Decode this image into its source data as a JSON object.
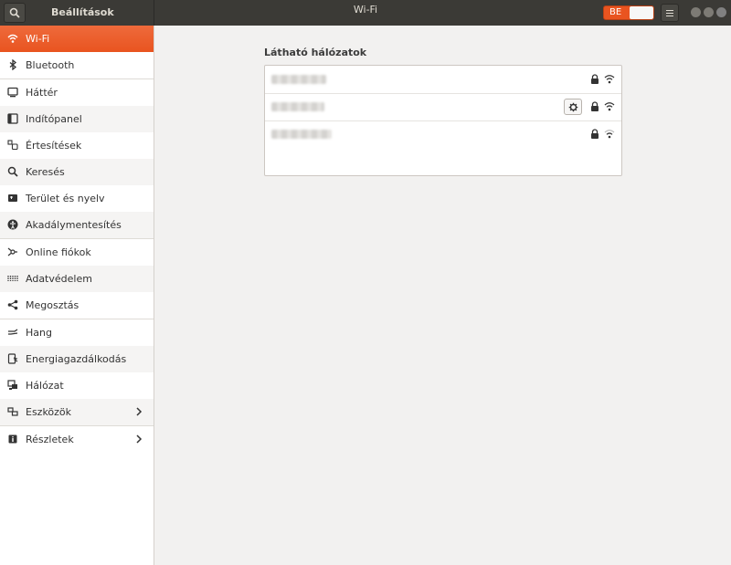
{
  "header": {
    "app_title": "Beállítások",
    "window_title": "Wi-Fi",
    "wifi_switch_label": "BE"
  },
  "sidebar": {
    "items": [
      {
        "label": "Wi-Fi",
        "icon": "wifi-icon",
        "active": true
      },
      {
        "label": "Bluetooth",
        "icon": "bluetooth-icon"
      },
      {
        "label": "Háttér",
        "icon": "background-icon"
      },
      {
        "label": "Indítópanel",
        "icon": "dock-icon"
      },
      {
        "label": "Értesítések",
        "icon": "notifications-icon"
      },
      {
        "label": "Keresés",
        "icon": "search-icon"
      },
      {
        "label": "Terület és nyelv",
        "icon": "region-icon"
      },
      {
        "label": "Akadálymentesítés",
        "icon": "accessibility-icon"
      },
      {
        "label": "Online fiókok",
        "icon": "online-accounts-icon"
      },
      {
        "label": "Adatvédelem",
        "icon": "privacy-icon"
      },
      {
        "label": "Megosztás",
        "icon": "share-icon"
      },
      {
        "label": "Hang",
        "icon": "sound-icon"
      },
      {
        "label": "Energiagazdálkodás",
        "icon": "power-icon"
      },
      {
        "label": "Hálózat",
        "icon": "network-icon"
      },
      {
        "label": "Eszközök",
        "icon": "devices-icon",
        "has_submenu": true
      },
      {
        "label": "Részletek",
        "icon": "details-icon",
        "has_submenu": true
      }
    ]
  },
  "main": {
    "section_title": "Látható hálózatok"
  },
  "colors": {
    "accent": "#e95420",
    "header_bg": "#3b3a36",
    "window_bg": "#f2f1f0"
  }
}
